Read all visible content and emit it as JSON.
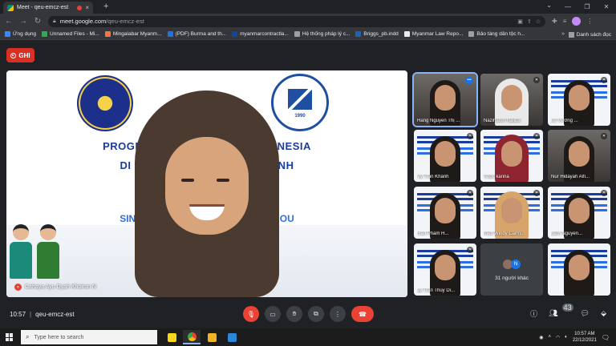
{
  "browser": {
    "tab_title": "Meet - qeu-emcz-est",
    "tab_close": "×",
    "new_tab": "+",
    "url_host": "meet.google.com",
    "url_path": "/qeu-emcz-est"
  },
  "bookmarks": [
    {
      "label": "Ứng dụng",
      "color": "#4285f4"
    },
    {
      "label": "Unnamed Files - Mi...",
      "color": "#34a853"
    },
    {
      "label": "Mingalabar Myanm...",
      "color": "#ff7043"
    },
    {
      "label": "(PDF) Burma and th...",
      "color": "#1a73e8"
    },
    {
      "label": "myanmarcontractla...",
      "color": "#0d47a1"
    },
    {
      "label": "Hệ thống pháp lý c...",
      "color": "#9aa0a6"
    },
    {
      "label": "Briggs_pb.indd",
      "color": "#1565c0"
    },
    {
      "label": "Myanmar Law Repo...",
      "color": "#e8eaed"
    },
    {
      "label": "Bảo tàng dân tộc h...",
      "color": "#9aa0a6"
    }
  ],
  "bookmarks_more": "»",
  "bookmarks_list": "Danh sách đọc",
  "recording": {
    "label": "GHI",
    "color": "#d93025"
  },
  "stage": {
    "banner_line1": "PROGRAM MAGA                  BAHASA INDONESIA",
    "banner_line2": "DI UNIVERSI                    KOTA HO CHI MINH",
    "banner_line3": "CHU                     N TẬP",
    "banner_line4": "SINH VIÊN UMM C                    INDONESIA TẠI OU",
    "logo_year": "1990",
    "speaker_name": "Cahaya Ayu Dyah Khoirun N"
  },
  "tiles": [
    {
      "name": "Hằng Nguyễn Thị ...",
      "state": "speaking"
    },
    {
      "name": "Nazihatun Najiba",
      "state": "muted"
    },
    {
      "name": "Lê Vương ...",
      "state": "muted"
    },
    {
      "name": "Vy Trần Khánh",
      "state": "muted"
    },
    {
      "name": "Aripti karina",
      "state": "muted"
    },
    {
      "name": "Nur Hidayah Alfi...",
      "state": "muted"
    },
    {
      "name": "Han Pham H...",
      "state": "muted"
    },
    {
      "name": "Inez Windy Carm...",
      "state": "muted"
    },
    {
      "name": "Lâm Nguyễn...",
      "state": "muted"
    },
    {
      "name": "Ly Tran Thuy Di...",
      "state": "muted"
    },
    {
      "name": "31 người khác",
      "state": "others"
    },
    {
      "name": "",
      "state": "slide"
    }
  ],
  "others_initial": "N",
  "bottombar": {
    "time": "10:57",
    "meeting_code": "qeu-emcz-est",
    "participants_count": "43"
  },
  "taskbar": {
    "search_placeholder": "Type here to search",
    "clock_time": "10:57 AM",
    "clock_date": "22/12/2021"
  }
}
